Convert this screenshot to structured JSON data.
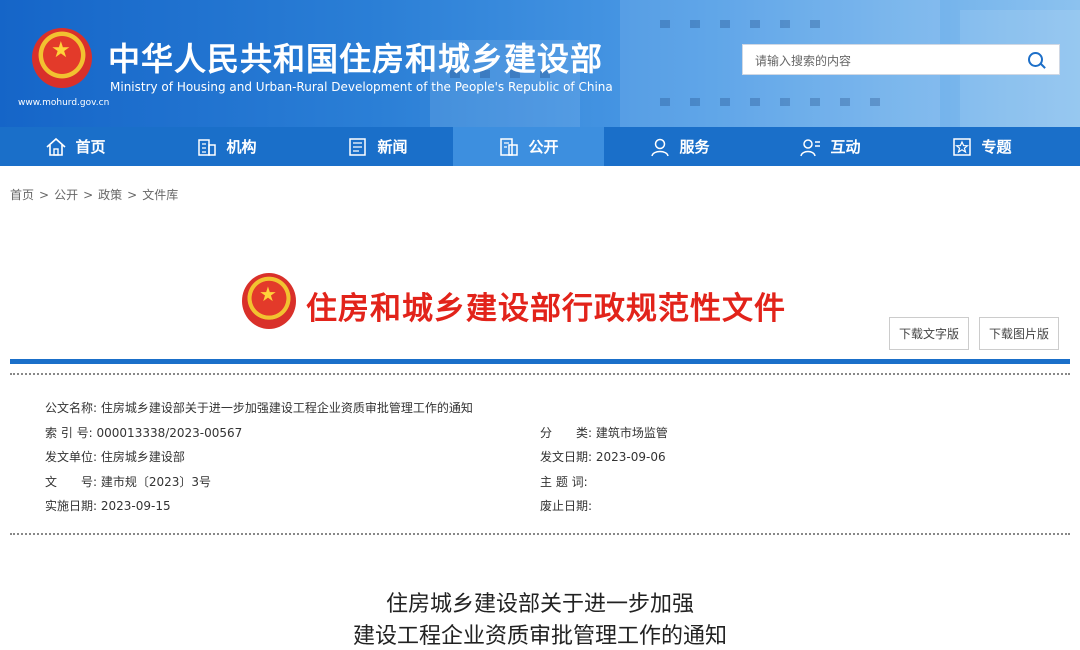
{
  "header": {
    "title": "中华人民共和国住房和城乡建设部",
    "subtitle": "Ministry of Housing and Urban-Rural Development of the People's Republic of China",
    "url": "www.mohurd.gov.cn",
    "search_placeholder": "请输入搜索的内容"
  },
  "nav": [
    {
      "label": "首页",
      "icon": "home-icon"
    },
    {
      "label": "机构",
      "icon": "building-icon"
    },
    {
      "label": "新闻",
      "icon": "news-icon"
    },
    {
      "label": "公开",
      "icon": "document-icon",
      "active": true
    },
    {
      "label": "服务",
      "icon": "service-icon"
    },
    {
      "label": "互动",
      "icon": "interaction-icon"
    },
    {
      "label": "专题",
      "icon": "topic-icon"
    }
  ],
  "breadcrumb": [
    "首页",
    "公开",
    "政策",
    "文件库"
  ],
  "doc_header": {
    "heading": "住房和城乡建设部行政规范性文件",
    "download_text": "下载文字版",
    "download_image": "下载图片版"
  },
  "meta": {
    "name_label": "公文名称:",
    "name_value": "住房城乡建设部关于进一步加强建设工程企业资质审批管理工作的通知",
    "index_label": "索 引 号:",
    "index_value": "000013338/2023-00567",
    "category_label": "分　　类:",
    "category_value": "建筑市场监管",
    "issuer_label": "发文单位:",
    "issuer_value": "住房城乡建设部",
    "date_label": "发文日期:",
    "date_value": "2023-09-06",
    "docno_label": "文　　号:",
    "docno_value": "建市规〔2023〕3号",
    "keywords_label": "主 题 词:",
    "keywords_value": "",
    "effective_label": "实施日期:",
    "effective_value": "2023-09-15",
    "expiry_label": "废止日期:",
    "expiry_value": ""
  },
  "doc_title": {
    "line1": "住房城乡建设部关于进一步加强",
    "line2": "建设工程企业资质审批管理工作的通知"
  },
  "colors": {
    "brand_blue": "#1a6fc9",
    "nav_active": "#3d8fdf",
    "heading_red": "#e2231a"
  }
}
